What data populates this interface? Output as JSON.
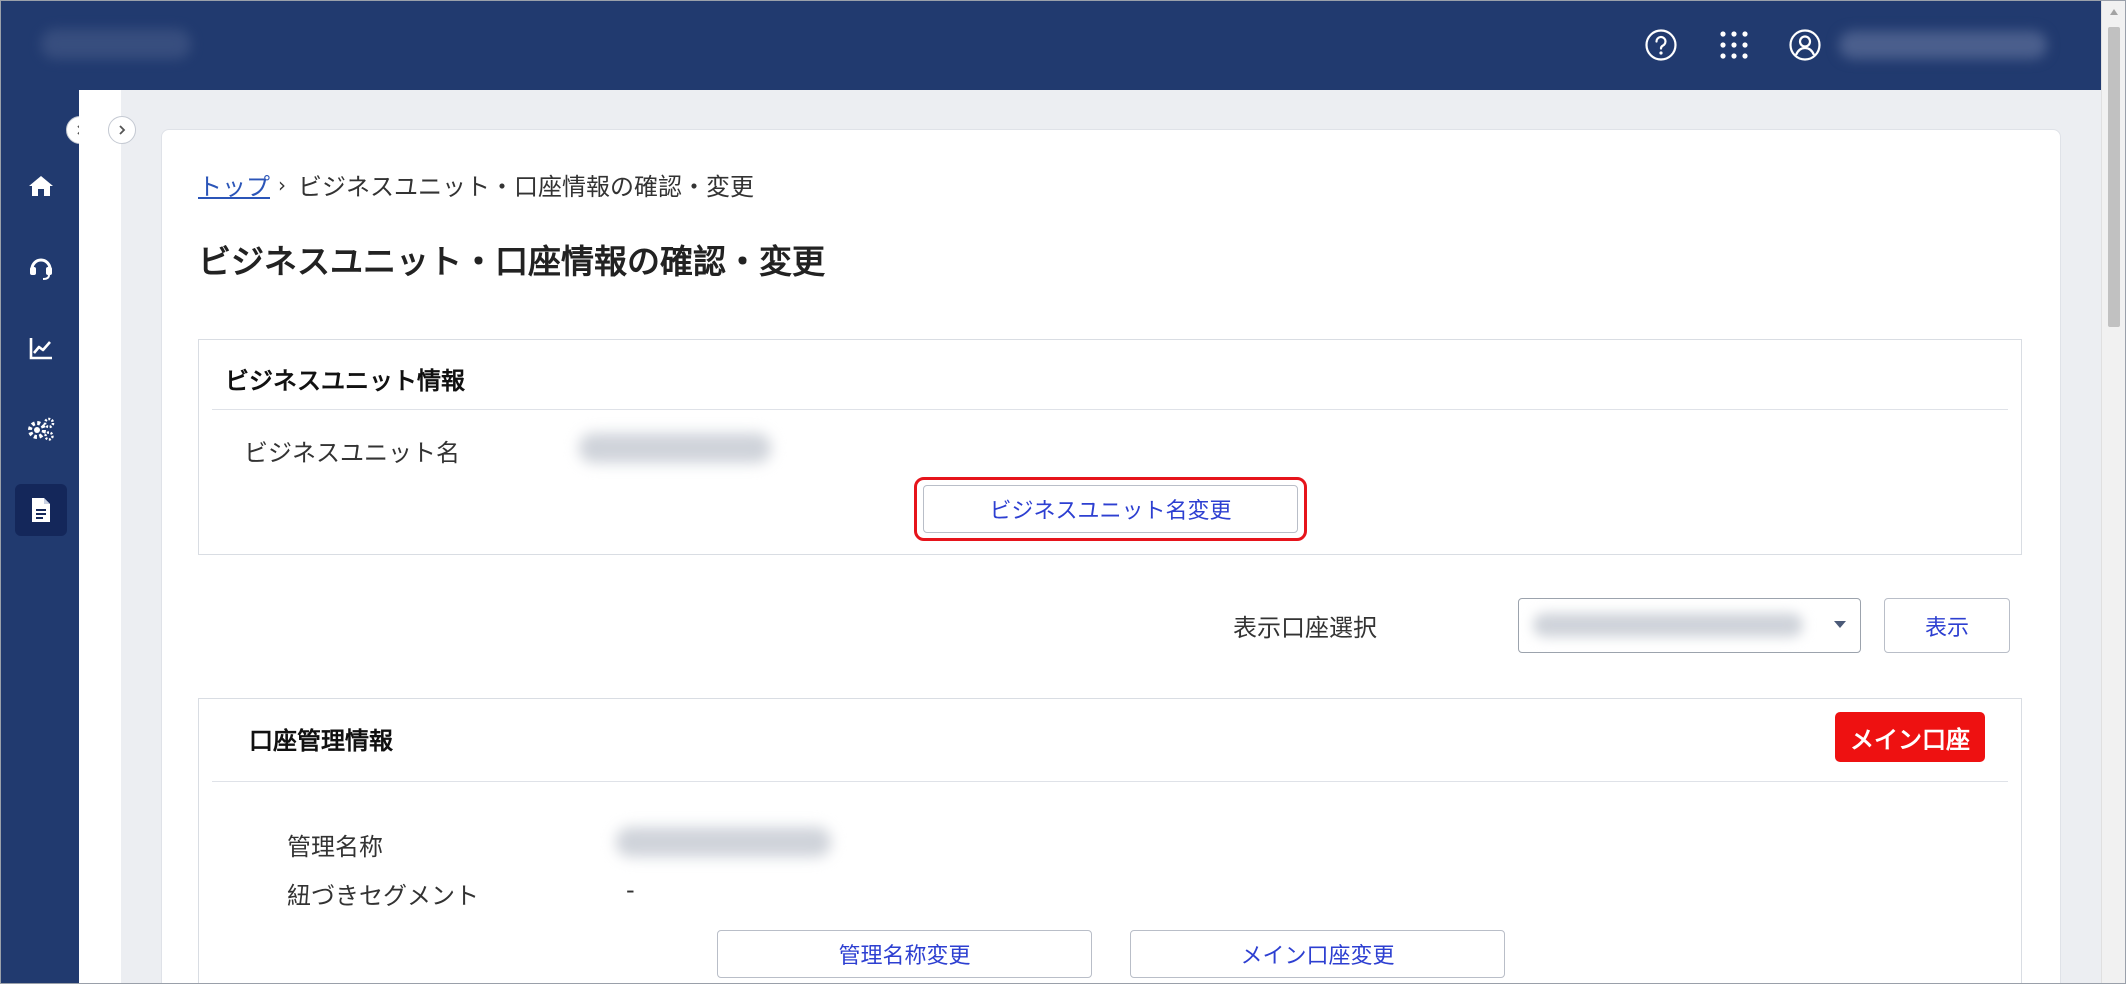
{
  "header": {
    "help_icon": "help-circle-icon",
    "apps_icon": "grid-dots-icon",
    "user_icon": "user-circle-icon"
  },
  "sidebar": {
    "items": [
      {
        "icon": "home-icon"
      },
      {
        "icon": "headset-icon"
      },
      {
        "icon": "chart-icon"
      },
      {
        "icon": "settings-icon"
      },
      {
        "icon": "document-icon",
        "active": true
      }
    ]
  },
  "breadcrumb": {
    "top": "トップ",
    "separator": "›",
    "current": "ビジネスユニット・口座情報の確認・変更"
  },
  "page": {
    "title": "ビジネスユニット・口座情報の確認・変更"
  },
  "business_unit": {
    "section_title": "ビジネスユニット情報",
    "name_label": "ビジネスユニット名",
    "change_button": "ビジネスユニット名変更"
  },
  "account_select": {
    "label": "表示口座選択",
    "show_button": "表示"
  },
  "account_management": {
    "section_title": "口座管理情報",
    "badge": "メイン口座",
    "name_label": "管理名称",
    "segment_label": "紐づきセグメント",
    "segment_value": "-",
    "rename_button": "管理名称変更",
    "main_change_button": "メイン口座変更"
  },
  "colors": {
    "header_bg": "#213a6f",
    "link": "#2b55b8",
    "button_text": "#2d3fd1",
    "badge_bg": "#ee1111",
    "highlight": "#e6141b"
  }
}
